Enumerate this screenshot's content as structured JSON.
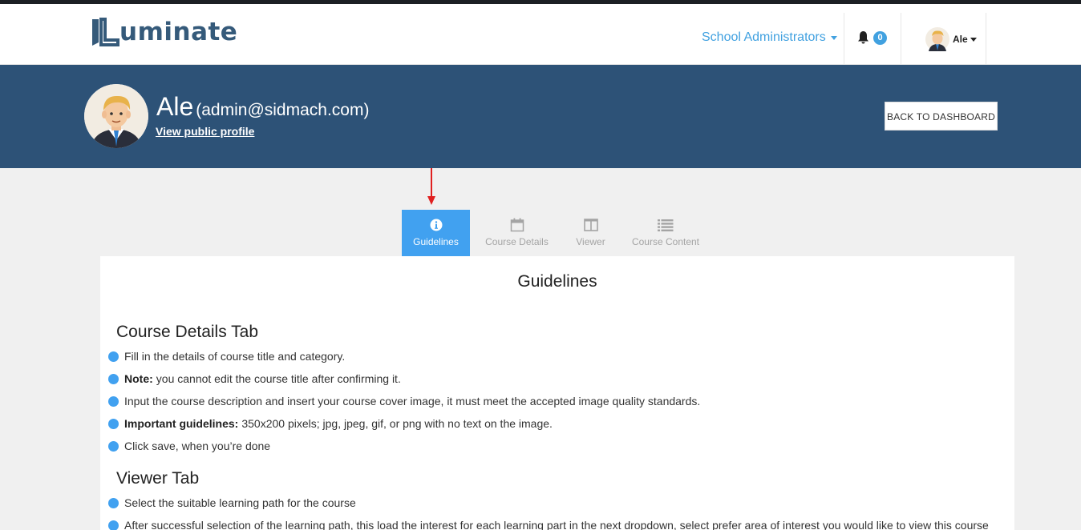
{
  "brand": {
    "logo_text": "uminate"
  },
  "navbar": {
    "role_label": "School Administrators",
    "notification_count": "0",
    "user_name": "Ale"
  },
  "profile": {
    "name": "Ale",
    "email": "(admin@sidmach.com)",
    "public_profile_link": "View public profile",
    "back_button": "BACK TO DASHBOARD"
  },
  "tabs": [
    {
      "label": "Guidelines",
      "icon": "info-icon",
      "active": true
    },
    {
      "label": "Course Details",
      "icon": "calendar-icon",
      "active": false
    },
    {
      "label": "Viewer",
      "icon": "columns-icon",
      "active": false
    },
    {
      "label": "Course Content",
      "icon": "list-icon",
      "active": false
    }
  ],
  "guidelines": {
    "title": "Guidelines",
    "sections": [
      {
        "title": "Course Details Tab",
        "items": [
          {
            "bold": "",
            "text": "Fill in the details of course title and category."
          },
          {
            "bold": "Note:",
            "text": "you cannot edit the course title after confirming it."
          },
          {
            "bold": "",
            "text": "Input the course description and insert your course cover image, it must meet the accepted image quality standards."
          },
          {
            "bold": "Important guidelines:",
            "text": "350x200 pixels; jpg, jpeg, gif, or png with no text on the image."
          },
          {
            "bold": "",
            "text": "Click save, when you’re done"
          }
        ]
      },
      {
        "title": "Viewer Tab",
        "items": [
          {
            "bold": "",
            "text": "Select the suitable learning path for the course"
          },
          {
            "bold": "",
            "text": "After successful selection of the learning path, this load the interest for each learning part in the next dropdown, select prefer area of interest you would like to view this course"
          }
        ]
      }
    ]
  },
  "colors": {
    "accent": "#41a1f0",
    "banner": "#2d5277",
    "logo": "#355a7a",
    "annotation_arrow": "#e02020"
  }
}
